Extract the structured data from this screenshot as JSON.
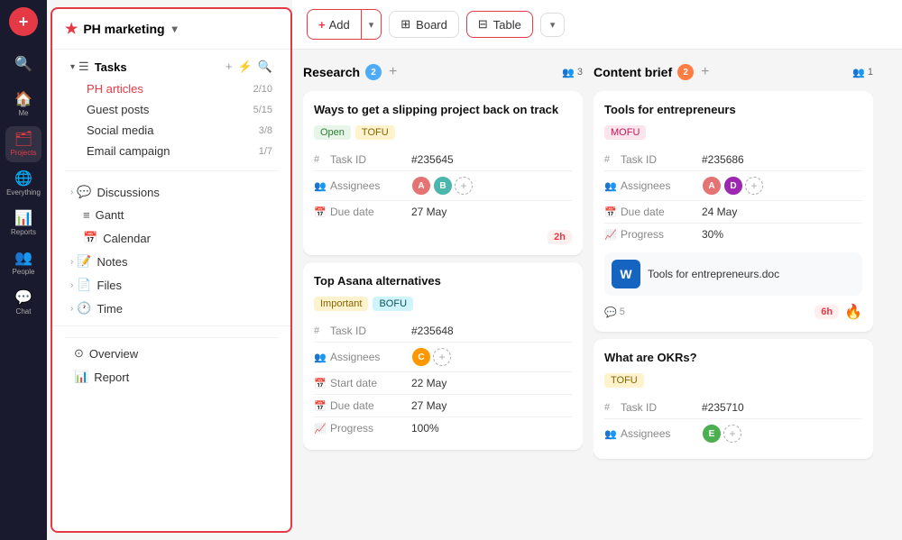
{
  "iconbar": {
    "add_label": "+",
    "items": [
      {
        "id": "search",
        "symbol": "🔍",
        "label": ""
      },
      {
        "id": "home",
        "symbol": "🏠",
        "label": "Me"
      },
      {
        "id": "projects",
        "symbol": "🗂",
        "label": "Projects"
      },
      {
        "id": "everything",
        "symbol": "🌐",
        "label": "Everything"
      },
      {
        "id": "reports",
        "symbol": "📊",
        "label": "Reports"
      },
      {
        "id": "people",
        "symbol": "👥",
        "label": "People"
      },
      {
        "id": "chat",
        "symbol": "💬",
        "label": "Chat"
      }
    ]
  },
  "sidebar": {
    "project_name": "PH marketing",
    "tasks_label": "Tasks",
    "subtasks": [
      {
        "label": "PH articles",
        "badge": "2/10",
        "active": true
      },
      {
        "label": "Guest posts",
        "badge": "5/15"
      },
      {
        "label": "Social media",
        "badge": "3/8"
      },
      {
        "label": "Email campaign",
        "badge": "1/7"
      }
    ],
    "items": [
      {
        "id": "discussions",
        "icon": "💬",
        "label": "Discussions",
        "expandable": true
      },
      {
        "id": "gantt",
        "icon": "≡",
        "label": "Gantt"
      },
      {
        "id": "calendar",
        "icon": "📅",
        "label": "Calendar"
      },
      {
        "id": "notes",
        "icon": "📝",
        "label": "Notes",
        "expandable": true
      },
      {
        "id": "files",
        "icon": "📄",
        "label": "Files",
        "expandable": true
      },
      {
        "id": "time",
        "icon": "🕐",
        "label": "Time",
        "expandable": true
      }
    ],
    "bottom_items": [
      {
        "id": "overview",
        "icon": "⊙",
        "label": "Overview"
      },
      {
        "id": "report",
        "icon": "📊",
        "label": "Report"
      }
    ]
  },
  "toolbar": {
    "add_label": "Add",
    "board_label": "Board",
    "table_label": "Table"
  },
  "columns": [
    {
      "id": "research",
      "title": "Research",
      "badge": "2",
      "people_count": "3",
      "cards": [
        {
          "id": "card1",
          "title": "Ways to get a slipping project back on track",
          "tags": [
            {
              "label": "Open",
              "type": "open"
            },
            {
              "label": "TOFU",
              "type": "tofu"
            }
          ],
          "task_id": "#235645",
          "assignees": [
            "#e57373",
            "#4db6ac"
          ],
          "due_date": "27 May",
          "footer_time": "2h",
          "show_doc": false
        },
        {
          "id": "card2",
          "title": "Top Asana alternatives",
          "tags": [
            {
              "label": "Important",
              "type": "important"
            },
            {
              "label": "BOFU",
              "type": "bofu"
            }
          ],
          "task_id": "#235648",
          "assignees": [
            "#ff9800"
          ],
          "start_date": "22 May",
          "due_date": "27 May",
          "progress": "100%",
          "footer_time": ""
        }
      ]
    },
    {
      "id": "content_brief",
      "title": "Content brief",
      "badge": "2",
      "people_count": "1",
      "cards": [
        {
          "id": "card3",
          "title": "Tools for entrepreneurs",
          "tags": [
            {
              "label": "MOFU",
              "type": "mofu"
            }
          ],
          "task_id": "#235686",
          "assignees": [
            "#e57373",
            "#9c27b0"
          ],
          "due_date": "24 May",
          "progress": "30%",
          "doc_name": "Tools for entrepreneurs.doc",
          "comments": "5",
          "footer_time": "6h",
          "has_fire": true
        },
        {
          "id": "card4",
          "title": "What are OKRs?",
          "tags": [
            {
              "label": "TOFU",
              "type": "tofu"
            }
          ],
          "task_id": "#235710",
          "assignees": [
            "#4caf50"
          ],
          "show_doc": false
        }
      ]
    }
  ]
}
